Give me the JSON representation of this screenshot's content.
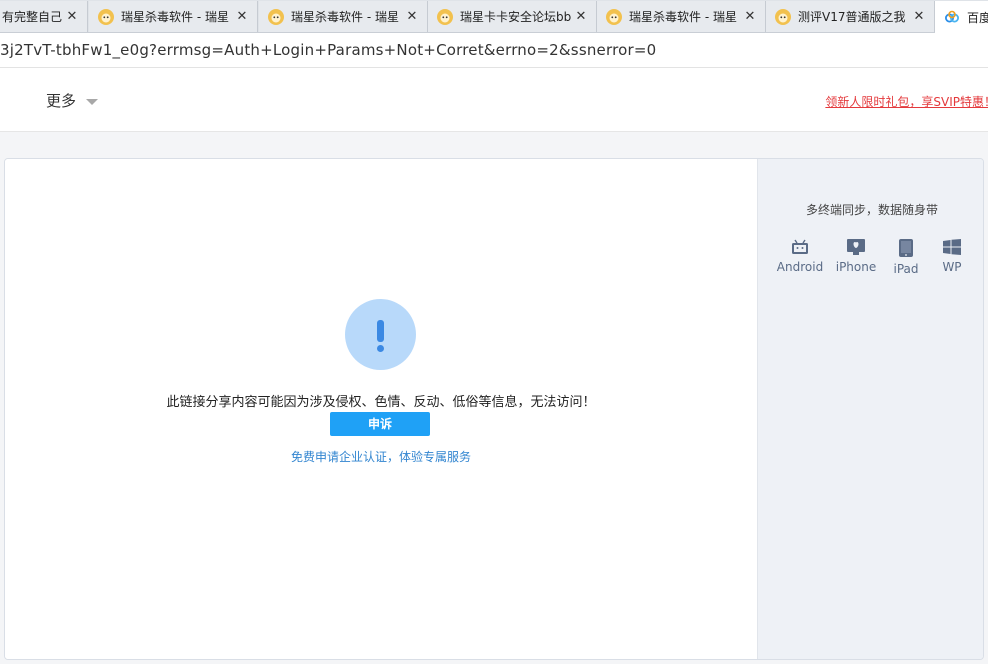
{
  "tabs": [
    {
      "title": "有完整自己",
      "active": false
    },
    {
      "title": "瑞星杀毒软件 - 瑞星",
      "active": false
    },
    {
      "title": "瑞星杀毒软件 - 瑞星",
      "active": false
    },
    {
      "title": "瑞星卡卡安全论坛bb",
      "active": false
    },
    {
      "title": "瑞星杀毒软件 - 瑞星",
      "active": false
    },
    {
      "title": "测评V17普通版之我",
      "active": false
    },
    {
      "title": "百度",
      "active": true
    }
  ],
  "address_bar": {
    "url": "3j2TvT-tbhFw1_e0g?errmsg=Auth+Login+Params+Not+Corret&errno=2&ssnerror=0"
  },
  "header": {
    "more_label": "更多",
    "promo_link": "领新人限时礼包，享SVIP特惠！"
  },
  "main": {
    "message": "此链接分享内容可能因为涉及侵权、色情、反动、低俗等信息，无法访问！",
    "appeal_button": "申诉",
    "enterprise_link": "免费申请企业认证，体验专属服务"
  },
  "sidebar": {
    "title": "多终端同步，数据随身带",
    "platforms": [
      {
        "label": "Android",
        "icon": "android-icon"
      },
      {
        "label": "iPhone",
        "icon": "iphone-icon"
      },
      {
        "label": "iPad",
        "icon": "ipad-icon"
      },
      {
        "label": "WP",
        "icon": "windows-phone-icon"
      }
    ]
  },
  "colors": {
    "accent": "#1fa1f6",
    "alert_circle": "#b8d9fa",
    "alert_mark": "#3b89e3",
    "promo": "#e4393c",
    "link": "#3285d0",
    "platform_icon": "#5a6b86"
  }
}
